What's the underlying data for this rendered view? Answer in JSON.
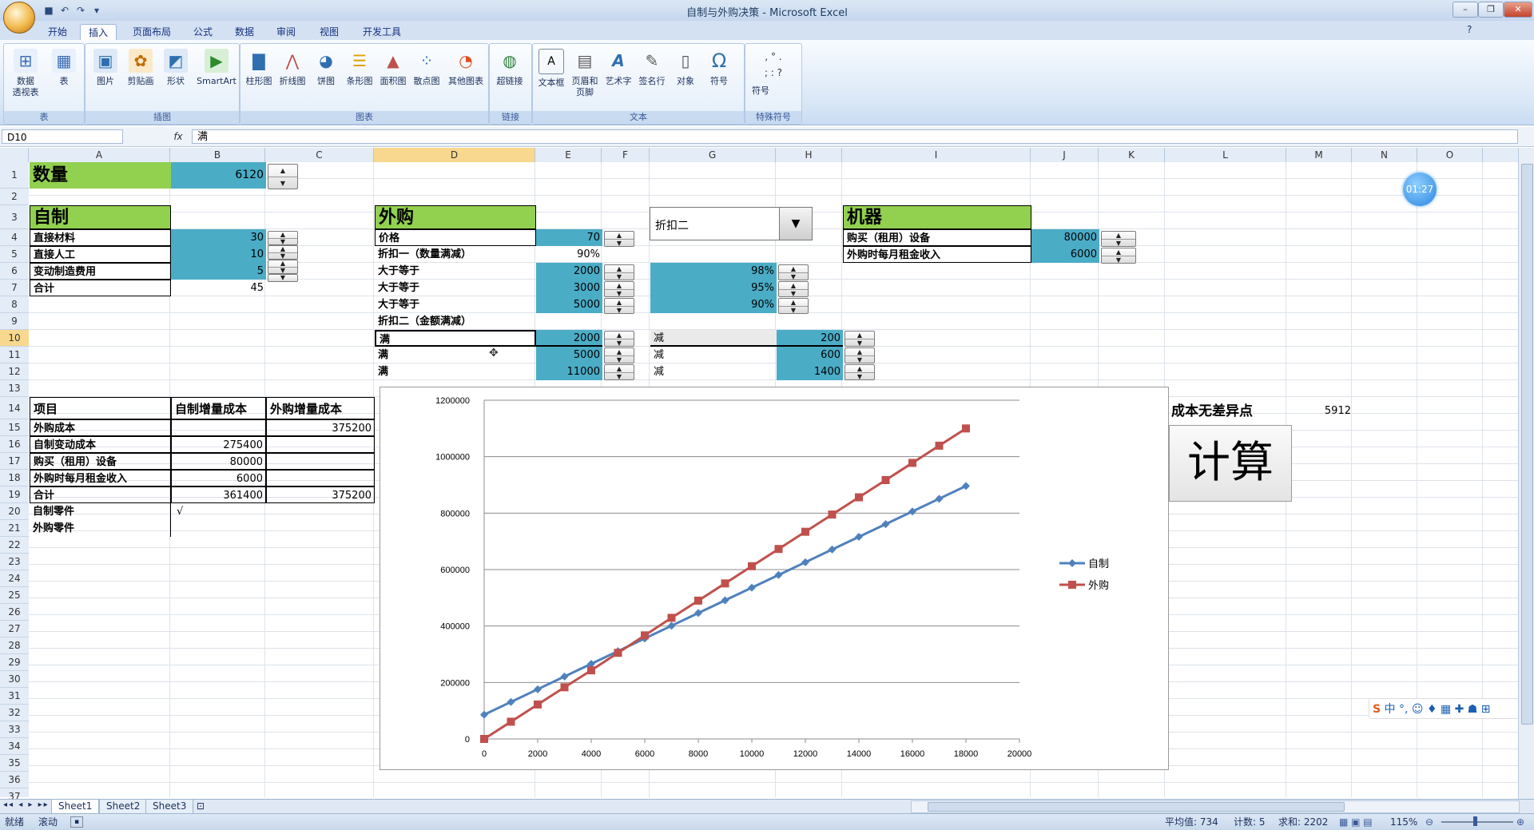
{
  "window": {
    "title": "自制与外购决策 - Microsoft Excel"
  },
  "ribbon": {
    "tabs": [
      "开始",
      "插入",
      "页面布局",
      "公式",
      "数据",
      "审阅",
      "视图",
      "开发工具"
    ],
    "active_tab": "插入",
    "groups": [
      {
        "label": "表",
        "buttons": [
          {
            "label": "数据\n透视表",
            "icon": "pivot-icon"
          },
          {
            "label": "表",
            "icon": "table-icon"
          }
        ]
      },
      {
        "label": "插图",
        "buttons": [
          {
            "label": "图片",
            "icon": "picture-icon"
          },
          {
            "label": "剪贴画",
            "icon": "clipart-icon"
          },
          {
            "label": "形状",
            "icon": "shapes-icon"
          },
          {
            "label": "SmartArt",
            "icon": "smartart-icon"
          }
        ]
      },
      {
        "label": "图表",
        "buttons": [
          {
            "label": "柱形图",
            "icon": "column-chart-icon"
          },
          {
            "label": "折线图",
            "icon": "line-chart-icon"
          },
          {
            "label": "饼图",
            "icon": "pie-chart-icon"
          },
          {
            "label": "条形图",
            "icon": "bar-chart-icon"
          },
          {
            "label": "面积图",
            "icon": "area-chart-icon"
          },
          {
            "label": "散点图",
            "icon": "scatter-chart-icon"
          },
          {
            "label": "其他图表",
            "icon": "other-chart-icon"
          }
        ]
      },
      {
        "label": "链接",
        "buttons": [
          {
            "label": "超链接",
            "icon": "hyperlink-icon"
          }
        ]
      },
      {
        "label": "文本",
        "buttons": [
          {
            "label": "文本框",
            "icon": "textbox-icon"
          },
          {
            "label": "页眉和\n页脚",
            "icon": "header-footer-icon"
          },
          {
            "label": "艺术字",
            "icon": "wordart-icon"
          },
          {
            "label": "签名行",
            "icon": "signature-icon"
          },
          {
            "label": "对象",
            "icon": "object-icon"
          },
          {
            "label": "符号",
            "icon": "omega-icon"
          }
        ]
      },
      {
        "label": "特殊符号",
        "buttons": [
          {
            "label": "符号",
            "icon": "special-symbol-icon"
          }
        ]
      }
    ]
  },
  "formula_bar": {
    "name_box": "D10",
    "fx": "fx",
    "content": "满"
  },
  "columns": [
    "A",
    "B",
    "C",
    "D",
    "E",
    "F",
    "G",
    "H",
    "I",
    "J",
    "K",
    "L",
    "M",
    "N",
    "O"
  ],
  "selected_column": "D",
  "rows": [
    "1",
    "2",
    "3",
    "4",
    "5",
    "6",
    "7",
    "8",
    "9",
    "10",
    "11",
    "12",
    "13",
    "14",
    "15",
    "16",
    "17",
    "18",
    "19",
    "20",
    "21",
    "22",
    "23",
    "24",
    "25",
    "26",
    "27",
    "28",
    "29",
    "30",
    "31",
    "32",
    "33",
    "34",
    "35",
    "36",
    "37"
  ],
  "selected_row": "10",
  "sheet": {
    "qty": {
      "label": "数量",
      "value": "6120"
    },
    "self_made": {
      "header": "自制",
      "rows": [
        {
          "label": "直接材料",
          "value": "30"
        },
        {
          "label": "直接人工",
          "value": "10"
        },
        {
          "label": "变动制造费用",
          "value": "5"
        },
        {
          "label": "合计",
          "value": "45"
        }
      ]
    },
    "purchase": {
      "header": "外购",
      "price_label": "价格",
      "price": "70",
      "discount1_label": "折扣一（数量满减）",
      "discount1_value": "90%",
      "tiers": [
        {
          "label": "大于等于",
          "qty": "2000",
          "rate": "98%"
        },
        {
          "label": "大于等于",
          "qty": "3000",
          "rate": "95%"
        },
        {
          "label": "大于等于",
          "qty": "5000",
          "rate": "90%"
        }
      ],
      "discount2_label": "折扣二（金额满减）",
      "amount_tiers": [
        {
          "label": "满",
          "amount": "2000",
          "minus_label": "减",
          "minus": "200"
        },
        {
          "label": "满",
          "amount": "5000",
          "minus_label": "减",
          "minus": "600"
        },
        {
          "label": "满",
          "amount": "11000",
          "minus_label": "减",
          "minus": "1400"
        }
      ]
    },
    "combo": {
      "selected": "折扣二"
    },
    "machine": {
      "header": "机器",
      "rows": [
        {
          "label": "购买（租用）设备",
          "value": "80000"
        },
        {
          "label": "外购时每月租金收入",
          "value": "6000"
        }
      ]
    },
    "analysis": {
      "headers": [
        "项目",
        "自制增量成本",
        "外购增量成本"
      ],
      "rows": [
        [
          "外购成本",
          "",
          "375200"
        ],
        [
          "自制变动成本",
          "275400",
          ""
        ],
        [
          "购买（租用）设备",
          "80000",
          ""
        ],
        [
          "外购时每月租金收入",
          "6000",
          ""
        ],
        [
          "合计",
          "361400",
          "375200"
        ],
        [
          "自制零件",
          "√",
          ""
        ],
        [
          "外购零件",
          "",
          ""
        ]
      ]
    },
    "breakeven": {
      "label": "成本无差异点",
      "value": "5912"
    },
    "calc_button": "计算"
  },
  "chart_data": {
    "type": "line",
    "x": [
      0,
      1000,
      2000,
      3000,
      4000,
      5000,
      6000,
      7000,
      8000,
      9000,
      10000,
      11000,
      12000,
      13000,
      14000,
      15000,
      16000,
      17000,
      18000
    ],
    "series": [
      {
        "name": "自制",
        "color": "#4f81bd",
        "marker": "diamond",
        "values": [
          86000,
          131000,
          176000,
          221000,
          266000,
          311000,
          356000,
          401000,
          446000,
          491000,
          536000,
          581000,
          626000,
          671000,
          716000,
          761000,
          806000,
          851000,
          896000
        ]
      },
      {
        "name": "外购",
        "color": "#c0504d",
        "marker": "square",
        "values": [
          0,
          61000,
          122000,
          183000,
          243000,
          305000,
          367000,
          429000,
          490000,
          551000,
          612000,
          673000,
          734000,
          795000,
          856000,
          917000,
          978000,
          1039000,
          1100000
        ]
      }
    ],
    "xlim": [
      0,
      20000
    ],
    "ylim": [
      0,
      1200000
    ],
    "x_ticks": [
      "0",
      "2000",
      "4000",
      "6000",
      "8000",
      "10000",
      "12000",
      "14000",
      "16000",
      "18000",
      "20000"
    ],
    "y_ticks": [
      "0",
      "200000",
      "400000",
      "600000",
      "800000",
      "1000000",
      "1200000"
    ],
    "legend": "right",
    "grid": true
  },
  "timer": "01:27",
  "ime_text": "中 °, ☺ ♦ ▦ ✚ ☗ ⊞",
  "sheet_tabs": [
    "Sheet1",
    "Sheet2",
    "Sheet3"
  ],
  "active_sheet": "Sheet1",
  "status": {
    "ready": "就绪",
    "scroll": "滚动",
    "average": "平均值: 734",
    "count": "计数: 5",
    "sum": "求和: 2202",
    "zoom": "115%"
  }
}
